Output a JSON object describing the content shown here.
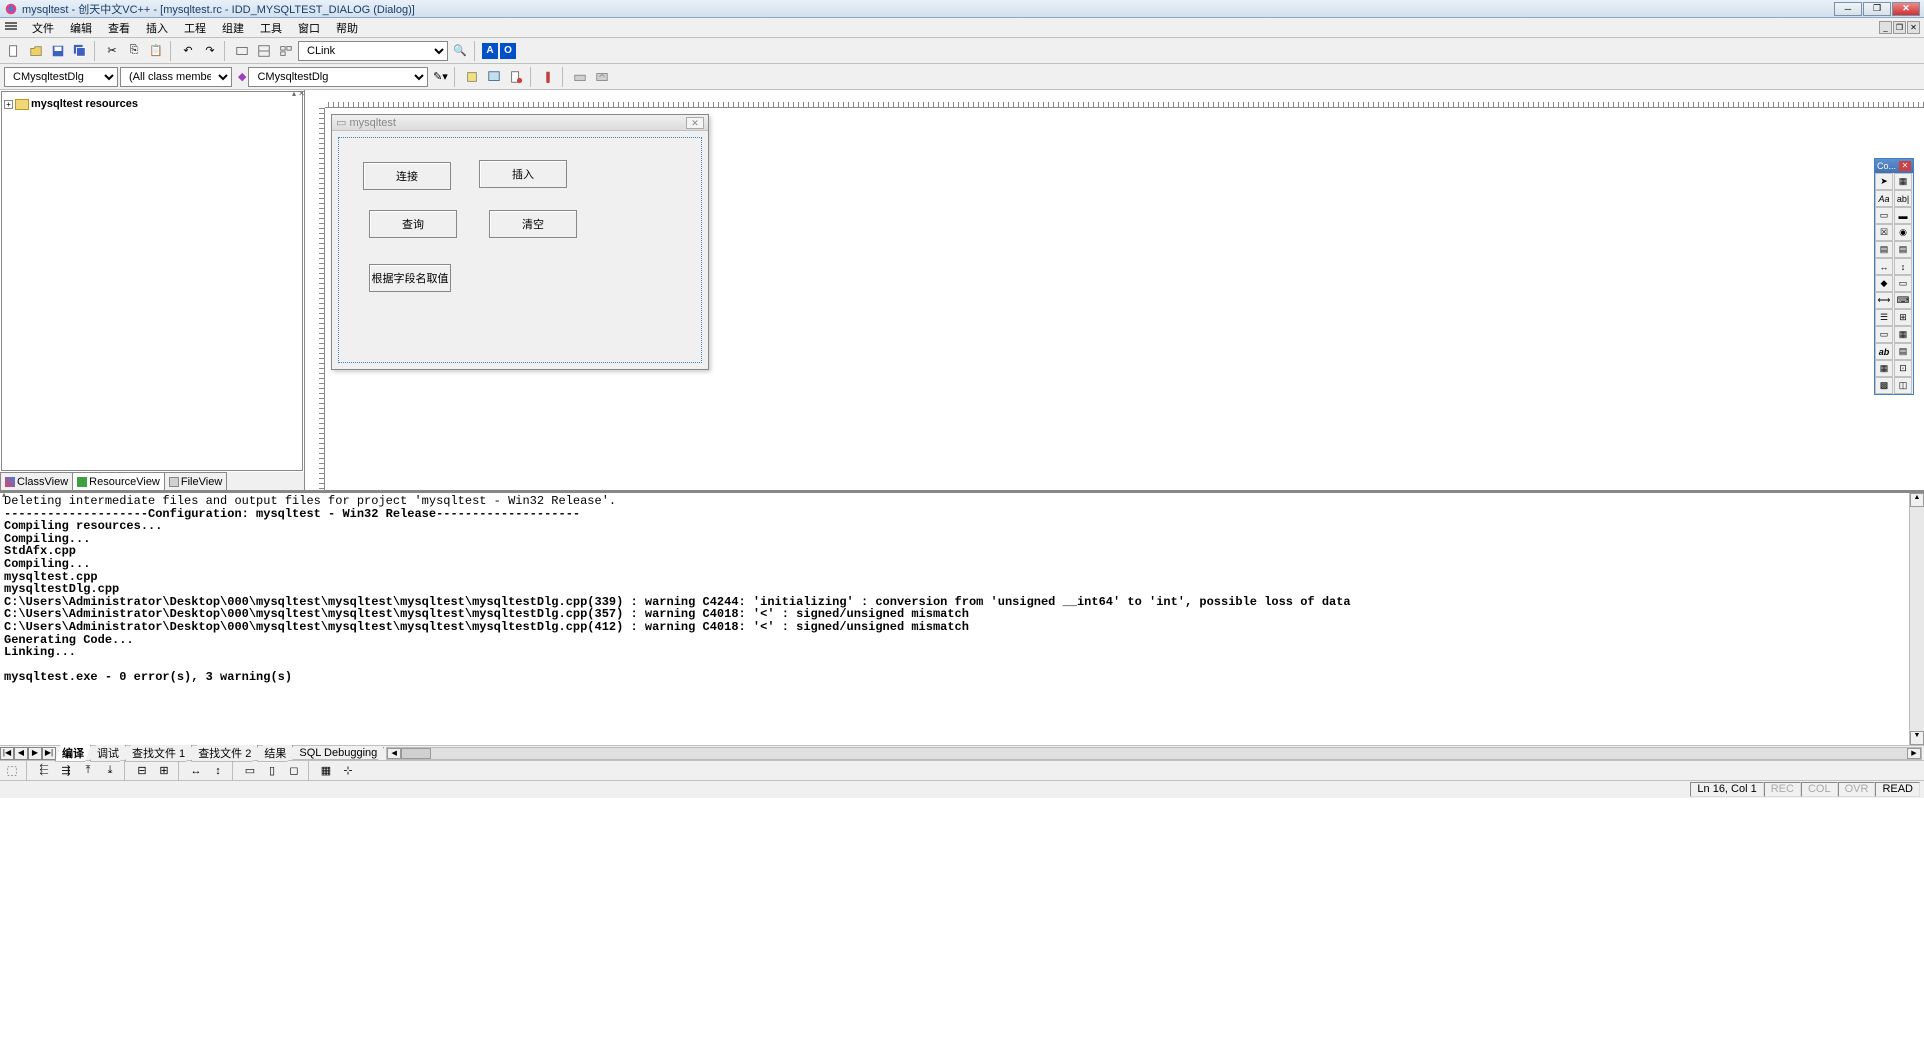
{
  "title": "mysqltest - 创天中文VC++ - [mysqltest.rc - IDD_MYSQLTEST_DIALOG (Dialog)]",
  "menu": {
    "file": "文件",
    "edit": "编辑",
    "view": "查看",
    "insert": "插入",
    "project": "工程",
    "build": "组建",
    "tools": "工具",
    "window": "窗口",
    "help": "帮助"
  },
  "combo1": "CLink",
  "class_combo": "CMysqltestDlg",
  "member_combo": "(All class members)",
  "func_combo": "CMysqltestDlg",
  "tree": {
    "root": "mysqltest resources"
  },
  "left_tabs": {
    "classview": "ClassView",
    "resourceview": "ResourceView",
    "fileview": "FileView"
  },
  "dialog": {
    "title": "mysqltest",
    "buttons": {
      "connect": "连接",
      "insert": "插入",
      "query": "查询",
      "clear": "清空",
      "byfield": "根据字段名取值"
    }
  },
  "toolbox_title": "Co...",
  "output": {
    "line1": "Deleting intermediate files and output files for project 'mysqltest - Win32 Release'.",
    "line2": "--------------------Configuration: mysqltest - Win32 Release--------------------",
    "line3": "Compiling resources...",
    "line4": "Compiling...",
    "line5": "StdAfx.cpp",
    "line6": "Compiling...",
    "line7": "mysqltest.cpp",
    "line8": "mysqltestDlg.cpp",
    "line9": "C:\\Users\\Administrator\\Desktop\\000\\mysqltest\\mysqltest\\mysqltest\\mysqltestDlg.cpp(339) : warning C4244: 'initializing' : conversion from 'unsigned __int64' to 'int', possible loss of data",
    "line10": "C:\\Users\\Administrator\\Desktop\\000\\mysqltest\\mysqltest\\mysqltest\\mysqltestDlg.cpp(357) : warning C4018: '<' : signed/unsigned mismatch",
    "line11": "C:\\Users\\Administrator\\Desktop\\000\\mysqltest\\mysqltest\\mysqltest\\mysqltestDlg.cpp(412) : warning C4018: '<' : signed/unsigned mismatch",
    "line12": "Generating Code...",
    "line13": "Linking...",
    "line14": "",
    "line15": "mysqltest.exe - 0 error(s), 3 warning(s)"
  },
  "out_tabs": {
    "build": "编译",
    "debug": "调试",
    "find1": "查找文件 1",
    "find2": "查找文件 2",
    "results": "结果",
    "sql": "SQL Debugging"
  },
  "status": {
    "pos": "Ln 16, Col 1",
    "rec": "REC",
    "col": "COL",
    "ovr": "OVR",
    "read": "READ"
  }
}
